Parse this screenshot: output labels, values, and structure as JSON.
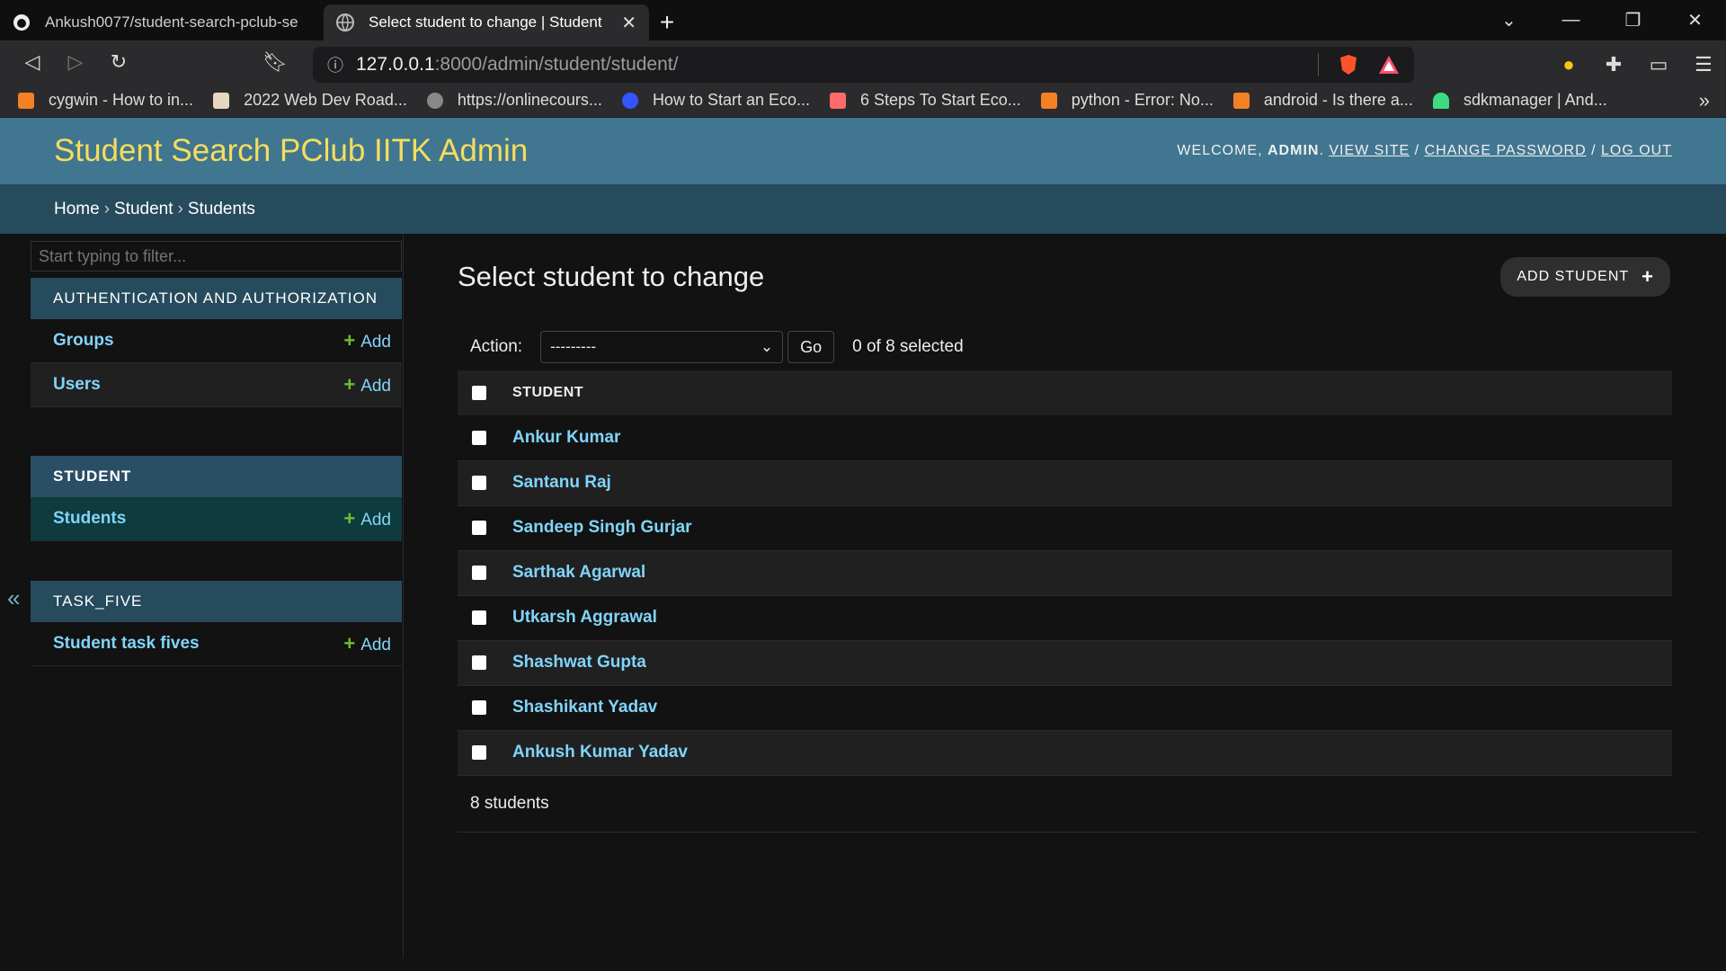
{
  "browser": {
    "tabs": [
      {
        "title": "Ankush0077/student-search-pclub-se",
        "active": false,
        "icon": "github-icon"
      },
      {
        "title": "Select student to change | Student",
        "active": true,
        "icon": "globe-icon"
      }
    ],
    "url_host": "127.0.0.1",
    "url_path": ":8000/admin/student/student/",
    "bookmarks": [
      {
        "label": "cygwin - How to in...",
        "icon": "stackoverflow-icon",
        "color": "#f48024"
      },
      {
        "label": "2022 Web Dev Road...",
        "icon": "page-icon",
        "color": "#e8d7c0"
      },
      {
        "label": "https://onlinecours...",
        "icon": "globe-icon",
        "color": "#888888"
      },
      {
        "label": "How to Start an Eco...",
        "icon": "circle-icon",
        "color": "#3355ff"
      },
      {
        "label": "6 Steps To Start Eco...",
        "icon": "page-icon",
        "color": "#ff6b6b"
      },
      {
        "label": "python - Error: No...",
        "icon": "stackoverflow-icon",
        "color": "#f48024"
      },
      {
        "label": "android - Is there a...",
        "icon": "stackoverflow-icon",
        "color": "#f48024"
      },
      {
        "label": "sdkmanager | And...",
        "icon": "android-icon",
        "color": "#3ddc84"
      }
    ]
  },
  "admin": {
    "brand": "Student Search PClub IITK Admin",
    "welcome": "WELCOME,",
    "user": "ADMIN",
    "view_site": "VIEW SITE",
    "change_password": "CHANGE PASSWORD",
    "log_out": "LOG OUT"
  },
  "breadcrumbs": {
    "home": "Home",
    "app": "Student",
    "model": "Students"
  },
  "sidebar": {
    "filter_placeholder": "Start typing to filter...",
    "modules": [
      {
        "caption": "AUTHENTICATION AND AUTHORIZATION",
        "items": [
          {
            "name": "Groups",
            "add": "Add"
          },
          {
            "name": "Users",
            "add": "Add"
          }
        ]
      },
      {
        "caption": "STUDENT",
        "items": [
          {
            "name": "Students",
            "add": "Add"
          }
        ]
      },
      {
        "caption": "TASK_FIVE",
        "items": [
          {
            "name": "Student task fives",
            "add": "Add"
          }
        ]
      }
    ]
  },
  "content": {
    "title": "Select student to change",
    "add_button": "ADD STUDENT",
    "action_label": "Action:",
    "action_value": "---------",
    "go": "Go",
    "selected": "0 of 8 selected",
    "column": "STUDENT",
    "rows": [
      "Ankur Kumar",
      "Santanu Raj",
      "Sandeep Singh Gurjar",
      "Sarthak Agarwal",
      "Utkarsh Aggrawal",
      "Shashwat Gupta",
      "Shashikant Yadav",
      "Ankush Kumar Yadav"
    ],
    "footer": "8 students"
  }
}
